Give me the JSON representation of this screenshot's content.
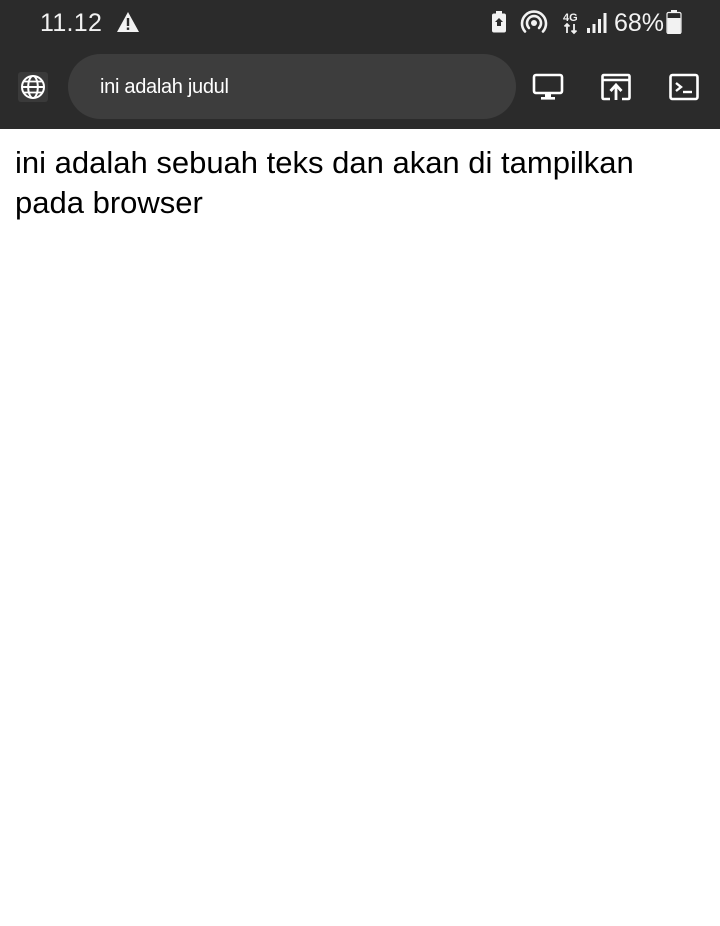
{
  "status_bar": {
    "time": "11.12",
    "battery_percent": "68%",
    "network_type": "4G",
    "icons": [
      "warning-icon",
      "battery-saver-icon",
      "hotspot-icon",
      "network-4g-icon",
      "signal-icon",
      "battery-icon"
    ]
  },
  "toolbar": {
    "page_title": "ini adalah judul",
    "icons": [
      "globe-icon",
      "desktop-icon",
      "upload-icon",
      "terminal-icon"
    ]
  },
  "page": {
    "body_text": "ini adalah sebuah teks dan akan di tampilkan pada browser"
  },
  "colors": {
    "bar_bg": "#2b2b2b",
    "urlbar_bg": "#3d3d3d",
    "icon_fg": "#ffffff",
    "page_bg": "#ffffff",
    "text": "#000000"
  }
}
